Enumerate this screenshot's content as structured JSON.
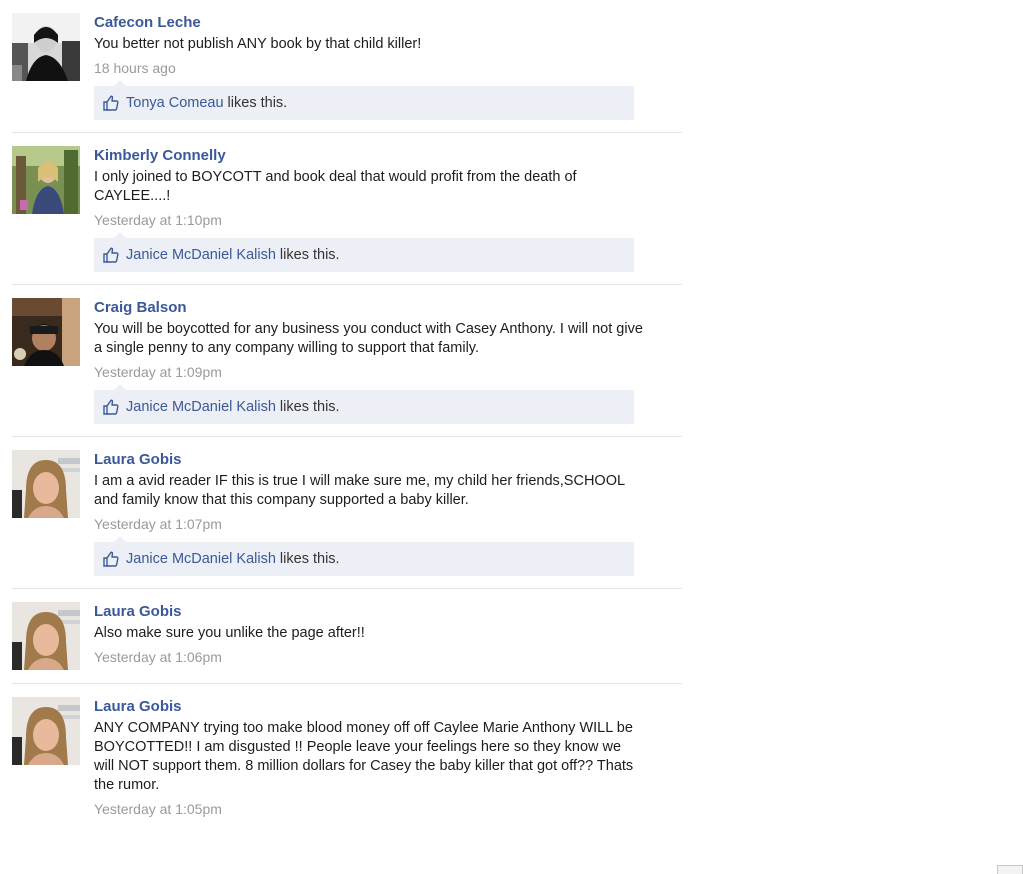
{
  "comments": [
    {
      "author": "Cafecon Leche",
      "text": "You better not publish ANY book by that child killer!",
      "time": "18 hours ago",
      "liker": "Tonya Comeau",
      "likes_suffix": " likes this.",
      "avatar": "bw-portrait"
    },
    {
      "author": "Kimberly Connelly",
      "text": "I only joined to BOYCOTT and book deal that would profit from the death of CAYLEE....!",
      "time": "Yesterday at 1:10pm",
      "liker": "Janice McDaniel Kalish",
      "likes_suffix": " likes this.",
      "avatar": "outdoor-woman"
    },
    {
      "author": "Craig Balson",
      "text": "You will be boycotted for any business you conduct with Casey Anthony. I will not give a single penny to any company willing to support that family.",
      "time": "Yesterday at 1:09pm",
      "liker": "Janice McDaniel Kalish",
      "likes_suffix": " likes this.",
      "avatar": "dark-portrait"
    },
    {
      "author": "Laura Gobis",
      "text": "I am a avid reader IF this is true I will make sure me, my child her friends,SCHOOL and family know that this company supported a baby killer.",
      "time": "Yesterday at 1:07pm",
      "liker": "Janice McDaniel Kalish",
      "likes_suffix": " likes this.",
      "avatar": "blonde-woman"
    },
    {
      "author": "Laura Gobis",
      "text": "Also make sure you unlike the page after!!",
      "time": "Yesterday at 1:06pm",
      "avatar": "blonde-woman"
    },
    {
      "author": "Laura Gobis",
      "text": "ANY COMPANY trying too make blood money off off Caylee Marie Anthony WILL be BOYCOTTED!! I am disgusted !! People leave your feelings here so they know we will NOT support them. 8 million dollars for Casey the baby killer that got off?? Thats the rumor.",
      "time": "Yesterday at 1:05pm",
      "avatar": "blonde-woman"
    }
  ],
  "icons": {
    "like": "thumbs-up-icon"
  },
  "colors": {
    "link": "#3b5998",
    "likes_bg": "#eceff5",
    "timestamp": "#9a9a9a",
    "divider": "#e3e5ea"
  }
}
